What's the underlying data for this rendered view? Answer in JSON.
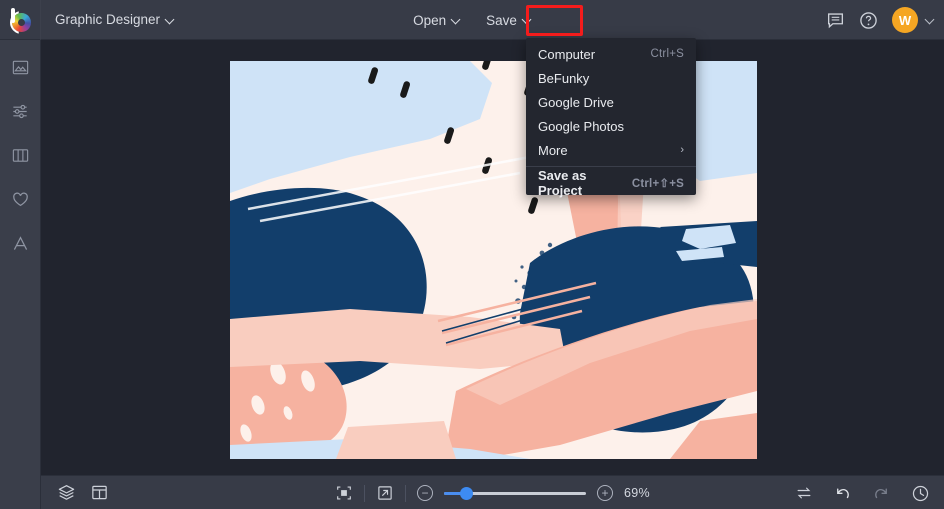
{
  "app": {
    "logo_name": "befunky-logo",
    "mode_label": "Graphic Designer",
    "background_color": "#2b2f3a",
    "accent_color": "#3d8bf2",
    "highlight_color": "#f41c1c"
  },
  "topbar": {
    "open_label": "Open",
    "save_label": "Save",
    "chat_icon": "chat-bubble-icon",
    "help_icon": "help-circle-icon",
    "avatar_initial": "W",
    "avatar_color": "#f5a623"
  },
  "save_menu": {
    "items": [
      {
        "label": "Computer",
        "shortcut": "Ctrl+S",
        "arrow": "",
        "bold": false
      },
      {
        "label": "BeFunky",
        "shortcut": "",
        "arrow": "",
        "bold": false
      },
      {
        "label": "Google Drive",
        "shortcut": "",
        "arrow": "",
        "bold": false
      },
      {
        "label": "Google Photos",
        "shortcut": "",
        "arrow": "",
        "bold": false
      },
      {
        "label": "More",
        "shortcut": "",
        "arrow": "›",
        "bold": false
      },
      {
        "label": "Save as Project",
        "shortcut": "Ctrl+⇧+S",
        "arrow": "",
        "bold": true
      }
    ]
  },
  "sidebar": {
    "items": [
      {
        "name": "sidebar-item-image",
        "icon": "image-icon"
      },
      {
        "name": "sidebar-item-adjust",
        "icon": "sliders-icon"
      },
      {
        "name": "sidebar-item-templates",
        "icon": "columns-icon"
      },
      {
        "name": "sidebar-item-favorites",
        "icon": "heart-icon"
      },
      {
        "name": "sidebar-item-text",
        "icon": "text-a-icon"
      }
    ]
  },
  "bottombar": {
    "layers_icon": "layers-icon",
    "layout_icon": "layout-panel-icon",
    "fit_icon": "fit-to-screen-icon",
    "expand_icon": "expand-arrow-icon",
    "zoom_out_label": "−",
    "zoom_in_label": "+",
    "zoom_value": "69%",
    "zoom_percent": 69,
    "compare_icon": "compare-swap-icon",
    "undo_icon": "undo-arrow-icon",
    "redo_icon": "redo-arrow-icon",
    "history_icon": "history-clock-icon"
  },
  "canvas": {
    "artwork_name": "abstract-brush-strokes-design",
    "palette": {
      "cream": "#fdf1eb",
      "light_blue": "#cfe3f7",
      "navy": "#123e6b",
      "salmon": "#f6b2a0",
      "peach": "#f9cdbf",
      "black": "#1a1a1a"
    }
  }
}
